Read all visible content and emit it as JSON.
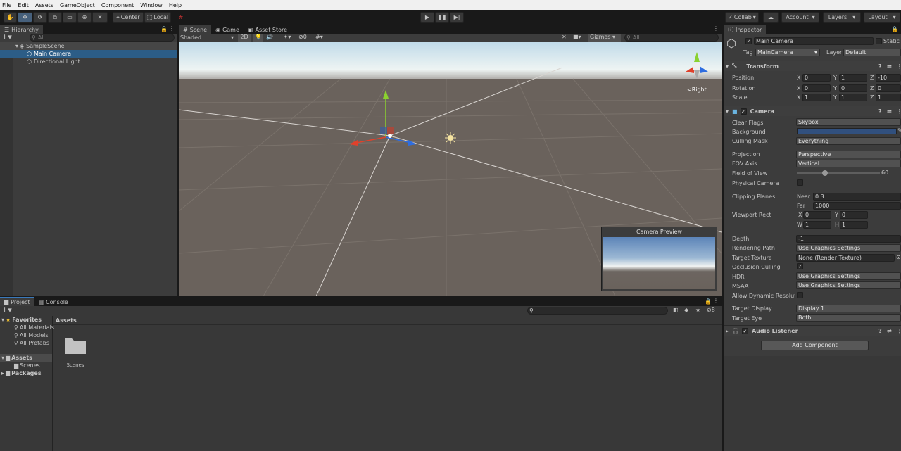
{
  "menu": [
    "File",
    "Edit",
    "Assets",
    "GameObject",
    "Component",
    "Window",
    "Help"
  ],
  "toolbar": {
    "pivot_mode": "Center",
    "pivot_rotation": "Local",
    "collab": "Collab",
    "account": "Account",
    "layers": "Layers",
    "layout": "Layout"
  },
  "hierarchy": {
    "tab": "Hierarchy",
    "search_placeholder": "All",
    "scene": "SampleScene",
    "items": [
      "Main Camera",
      "Directional Light"
    ]
  },
  "scene_view": {
    "tabs": [
      "Scene",
      "Game",
      "Asset Store"
    ],
    "shading": "Shaded",
    "mode_2d": "2D",
    "hidden_count": "0",
    "gizmos": "Gizmos",
    "search_placeholder": "All",
    "gizmo_label": "<Right",
    "camera_preview_title": "Camera Preview"
  },
  "project": {
    "tabs": [
      "Project",
      "Console"
    ],
    "favorites_label": "Favorites",
    "favorites": [
      "All Materials",
      "All Models",
      "All Prefabs"
    ],
    "assets_label": "Assets",
    "assets_children": [
      "Scenes"
    ],
    "packages_label": "Packages",
    "breadcrumb": "Assets",
    "files": [
      "Scenes"
    ],
    "hidden_count": "8"
  },
  "inspector": {
    "tab": "Inspector",
    "object_name": "Main Camera",
    "static_label": "Static",
    "tag_label": "Tag",
    "tag_value": "MainCamera",
    "layer_label": "Layer",
    "layer_value": "Default",
    "transform": {
      "title": "Transform",
      "position_label": "Position",
      "rotation_label": "Rotation",
      "scale_label": "Scale",
      "position": {
        "x": "0",
        "y": "1",
        "z": "-10"
      },
      "rotation": {
        "x": "0",
        "y": "0",
        "z": "0"
      },
      "scale": {
        "x": "1",
        "y": "1",
        "z": "1"
      }
    },
    "camera": {
      "title": "Camera",
      "clear_flags_label": "Clear Flags",
      "clear_flags": "Skybox",
      "background_label": "Background",
      "background_color": "#31507e",
      "culling_mask_label": "Culling Mask",
      "culling_mask": "Everything",
      "projection_label": "Projection",
      "projection": "Perspective",
      "fov_axis_label": "FOV Axis",
      "fov_axis": "Vertical",
      "fov_label": "Field of View",
      "fov": "60",
      "fov_fraction": 0.34,
      "physical_label": "Physical Camera",
      "clipping_label": "Clipping Planes",
      "near_label": "Near",
      "near": "0.3",
      "far_label": "Far",
      "far": "1000",
      "viewport_label": "Viewport Rect",
      "vp_x": "0",
      "vp_y": "0",
      "vp_w": "1",
      "vp_h": "1",
      "depth_label": "Depth",
      "depth": "-1",
      "rendering_path_label": "Rendering Path",
      "rendering_path": "Use Graphics Settings",
      "target_texture_label": "Target Texture",
      "target_texture": "None (Render Texture)",
      "occlusion_label": "Occlusion Culling",
      "hdr_label": "HDR",
      "hdr": "Use Graphics Settings",
      "msaa_label": "MSAA",
      "msaa": "Use Graphics Settings",
      "dynres_label": "Allow Dynamic Resolutio",
      "target_display_label": "Target Display",
      "target_display": "Display 1",
      "target_eye_label": "Target Eye",
      "target_eye": "Both"
    },
    "audio_listener": "Audio Listener",
    "add_component": "Add Component"
  }
}
